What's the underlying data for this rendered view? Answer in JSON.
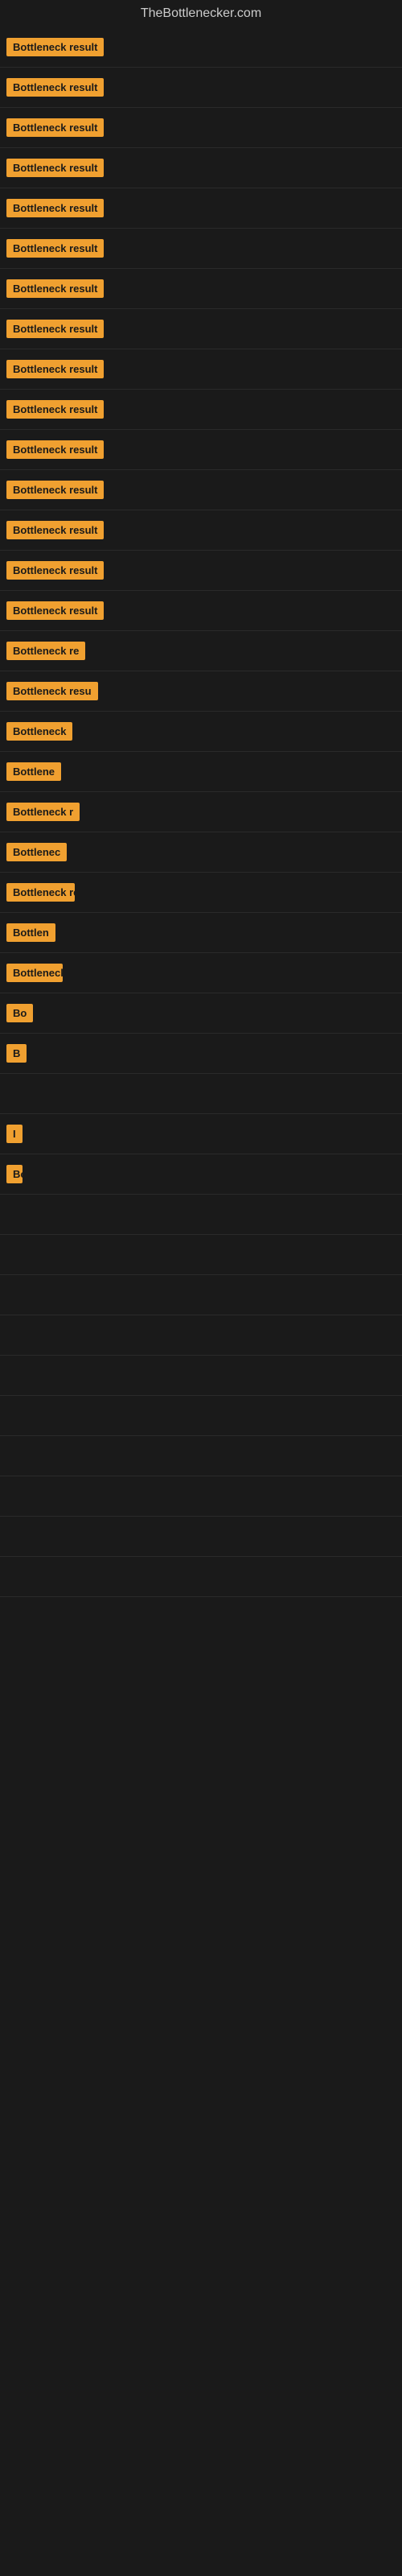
{
  "site": {
    "title": "TheBottlenecker.com"
  },
  "rows": [
    {
      "label": "Bottleneck result",
      "size": "full"
    },
    {
      "label": "Bottleneck result",
      "size": "full"
    },
    {
      "label": "Bottleneck result",
      "size": "full"
    },
    {
      "label": "Bottleneck result",
      "size": "full"
    },
    {
      "label": "Bottleneck result",
      "size": "full"
    },
    {
      "label": "Bottleneck result",
      "size": "full"
    },
    {
      "label": "Bottleneck result",
      "size": "full"
    },
    {
      "label": "Bottleneck result",
      "size": "full"
    },
    {
      "label": "Bottleneck result",
      "size": "full"
    },
    {
      "label": "Bottleneck result",
      "size": "full"
    },
    {
      "label": "Bottleneck result",
      "size": "full"
    },
    {
      "label": "Bottleneck result",
      "size": "full"
    },
    {
      "label": "Bottleneck result",
      "size": "full"
    },
    {
      "label": "Bottleneck result",
      "size": "full"
    },
    {
      "label": "Bottleneck result",
      "size": "full"
    },
    {
      "label": "Bottleneck re",
      "size": "large"
    },
    {
      "label": "Bottleneck resu",
      "size": "large"
    },
    {
      "label": "Bottleneck",
      "size": "medium"
    },
    {
      "label": "Bottlene",
      "size": "medium"
    },
    {
      "label": "Bottleneck r",
      "size": "small"
    },
    {
      "label": "Bottlenec",
      "size": "small"
    },
    {
      "label": "Bottleneck re",
      "size": "smaller"
    },
    {
      "label": "Bottlen",
      "size": "smaller"
    },
    {
      "label": "Bottleneck",
      "size": "tiny"
    },
    {
      "label": "Bo",
      "size": "tiny"
    },
    {
      "label": "B",
      "size": "micro"
    },
    {
      "label": "",
      "size": "nano"
    },
    {
      "label": "I",
      "size": "nano"
    },
    {
      "label": "Bott",
      "size": "pico"
    },
    {
      "label": "",
      "size": "zero"
    },
    {
      "label": "",
      "size": "zero"
    },
    {
      "label": "",
      "size": "zero"
    },
    {
      "label": "",
      "size": "zero"
    },
    {
      "label": "",
      "size": "zero"
    },
    {
      "label": "",
      "size": "zero"
    },
    {
      "label": "",
      "size": "zero"
    },
    {
      "label": "",
      "size": "zero"
    },
    {
      "label": "",
      "size": "zero"
    },
    {
      "label": "",
      "size": "zero"
    }
  ]
}
